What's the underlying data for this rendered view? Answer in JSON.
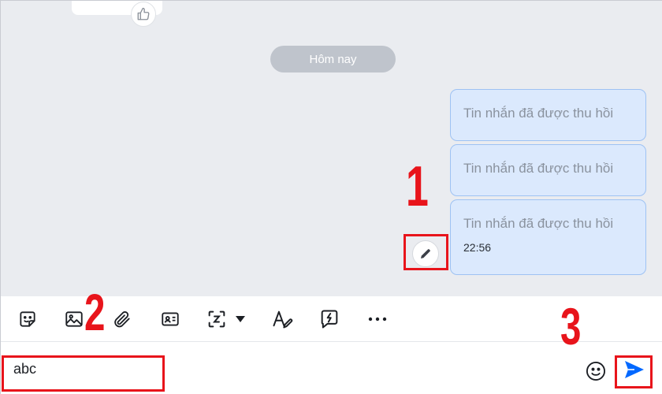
{
  "chat": {
    "date_separator": "Hôm nay",
    "messages": [
      {
        "text": "Tin nhắn đã được thu hồi"
      },
      {
        "text": "Tin nhắn đã được thu hồi"
      },
      {
        "text": "Tin nhắn đã được thu hồi",
        "time": "22:56"
      }
    ]
  },
  "annotations": {
    "step1": "1",
    "step2": "2",
    "step3": "3"
  },
  "toolbar": {
    "icons": [
      "sticker-icon",
      "image-icon",
      "attachment-icon",
      "contact-card-icon",
      "screenshot-icon",
      "text-format-icon",
      "quick-message-icon",
      "more-icon"
    ]
  },
  "composer": {
    "input_value": "abc"
  },
  "colors": {
    "accent": "#0068ff",
    "annotation_red": "#e8141b",
    "bubble_bg": "#dbe9fd",
    "chat_bg": "#eaecf0"
  }
}
